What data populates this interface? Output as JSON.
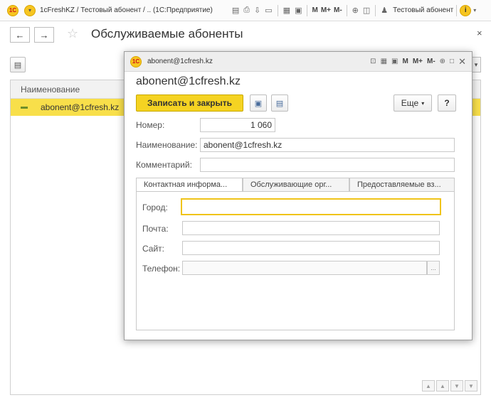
{
  "titlebar": {
    "logo": "1С",
    "title": "1cFreshKZ / Тестовый абонент /  .. (1С:Предприятие)",
    "user": "Тестовый абонент",
    "m": "M",
    "m_plus": "M+",
    "m_minus": "M-",
    "info": "i"
  },
  "page": {
    "title": "Обслуживаемые абоненты",
    "close": "×"
  },
  "list": {
    "column_header": "Наименование",
    "rows": [
      {
        "name": "abonent@1cfresh.kz"
      }
    ]
  },
  "modal": {
    "header_title": "abonent@1cfresh.kz",
    "heading": "abonent@1cfresh.kz",
    "save_close_label": "Записать и закрыть",
    "more_label": "Еще",
    "help_label": "?",
    "m": "M",
    "m_plus": "M+",
    "m_minus": "M-",
    "fields": {
      "number_label": "Номер:",
      "number_value": "1 060",
      "name_label": "Наименование:",
      "name_value": "abonent@1cfresh.kz",
      "comment_label": "Комментарий:",
      "comment_value": ""
    },
    "tabs": [
      "Контактная информа...",
      "Обслуживающие орг...",
      "Предоставляемые вз..."
    ],
    "contact": {
      "city_label": "Город:",
      "mail_label": "Почта:",
      "site_label": "Сайт:",
      "phone_label": "Телефон:",
      "dots": "..."
    }
  }
}
